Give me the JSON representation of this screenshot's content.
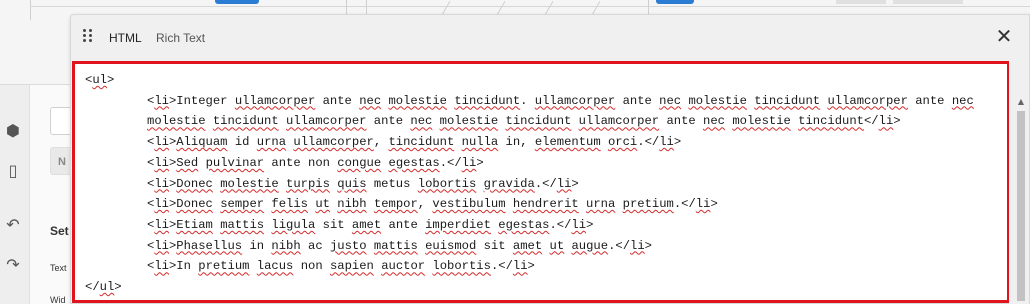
{
  "dialog": {
    "tabs": [
      {
        "label": "HTML",
        "active": true
      },
      {
        "label": "Rich Text",
        "active": false
      }
    ],
    "close_icon": "close-icon",
    "drag_icon": "drag-handle-icon"
  },
  "left_panel": {
    "setting_label": "Set",
    "text_label": "Text",
    "width_label": "Wid",
    "n_label": "N"
  },
  "left_rail_icons": [
    "components-icon",
    "device-icon",
    "undo-icon",
    "redo-icon"
  ],
  "code_editor": {
    "border_color": "#e0141e",
    "lines": [
      {
        "indent": false,
        "text": "<ul>"
      },
      {
        "indent": true,
        "text": "<li>Integer ullamcorper ante nec molestie tincidunt. ullamcorper ante nec molestie tincidunt ullamcorper ante nec molestie tincidunt ullamcorper ante nec molestie tincidunt ullamcorper ante nec molestie tincidunt</li>"
      },
      {
        "indent": true,
        "text": "<li>Aliquam id urna ullamcorper, tincidunt nulla in, elementum orci.</li>"
      },
      {
        "indent": true,
        "text": "<li>Sed pulvinar ante non congue egestas.</li>"
      },
      {
        "indent": true,
        "text": "<li>Donec molestie turpis quis metus lobortis gravida.</li>"
      },
      {
        "indent": true,
        "text": "<li>Donec semper felis ut nibh tempor, vestibulum hendrerit urna pretium.</li>"
      },
      {
        "indent": true,
        "text": "<li>Etiam mattis ligula sit amet ante imperdiet egestas.</li>"
      },
      {
        "indent": true,
        "text": "<li>Phasellus in nibh ac justo mattis euismod sit amet ut augue.</li>"
      },
      {
        "indent": true,
        "text": "<li>In pretium lacus non sapien auctor lobortis.</li>"
      },
      {
        "indent": false,
        "text": "</ul>"
      }
    ]
  },
  "colors": {
    "accent_blue": "#2b7cd3",
    "highlight_red": "#e0141e"
  }
}
